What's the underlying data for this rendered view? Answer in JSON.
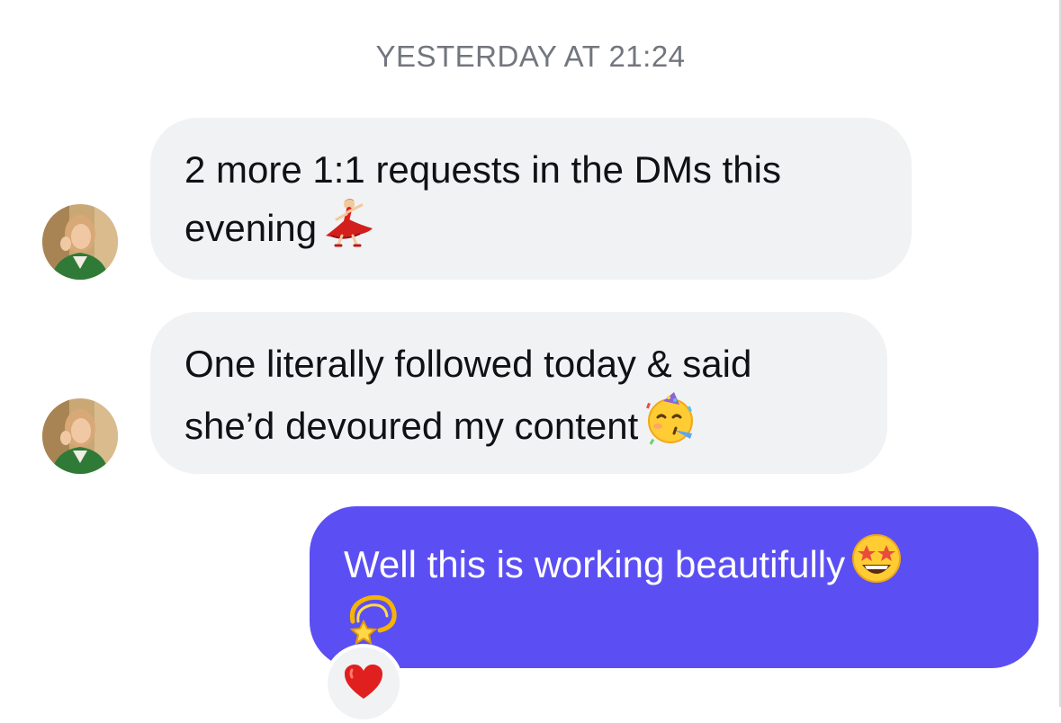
{
  "timestamp": "YESTERDAY AT 21:24",
  "messages": [
    {
      "direction": "incoming",
      "line1": "2 more 1:1 requests in the DMs this",
      "line2": "evening",
      "emojis": [
        "dancer-emoji"
      ]
    },
    {
      "direction": "incoming",
      "line1": "One literally followed today & said",
      "line2": "she’d devoured my content",
      "emojis": [
        "partying-face-emoji"
      ]
    },
    {
      "direction": "outgoing",
      "line1": "Well this is working beautifully",
      "line2": "",
      "emojis": [
        "star-struck-emoji",
        "dizzy-emoji"
      ]
    }
  ],
  "reaction": {
    "emoji": "red-heart-emoji"
  },
  "colors": {
    "incoming_bubble": "#f1f2f4",
    "outgoing_bubble": "#5b4ff3",
    "timestamp_text": "#72767e",
    "text_dark": "#101114",
    "text_light": "#ffffff"
  }
}
